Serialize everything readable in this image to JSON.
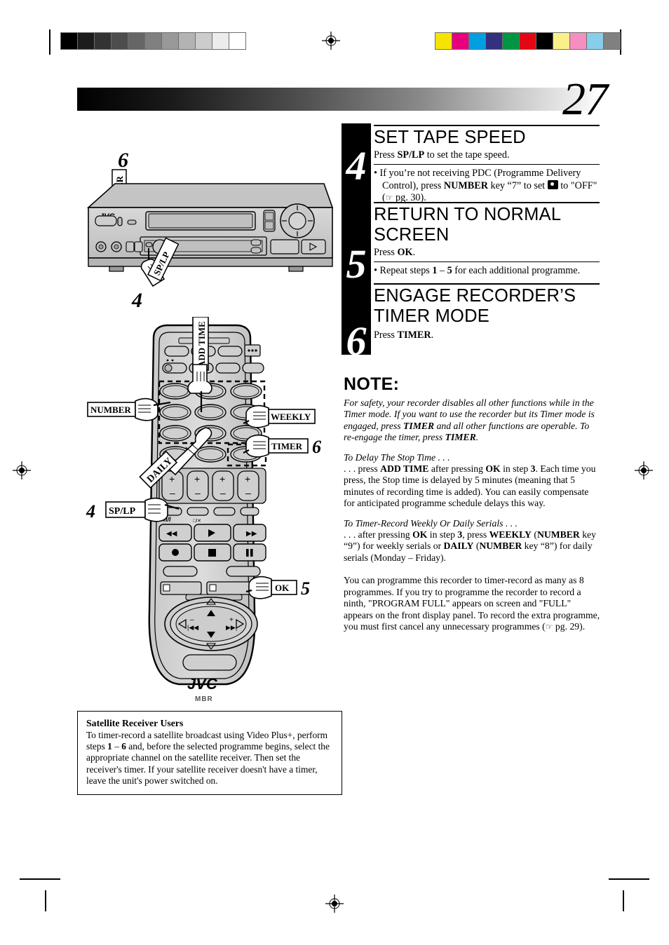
{
  "page": {
    "number": "27"
  },
  "printer_marks": {
    "grayscale_wedge": [
      "#000000",
      "#1c1c1c",
      "#333333",
      "#4d4d4d",
      "#666666",
      "#808080",
      "#999999",
      "#b3b3b3",
      "#cccccc",
      "#ececec",
      "#ffffff"
    ],
    "color_bar": [
      "#f5e400",
      "#e6007e",
      "#00a0e0",
      "#33307f",
      "#009543",
      "#e30613",
      "#000000",
      "#faf08a",
      "#f58fc2",
      "#87ceeb",
      "#808080"
    ]
  },
  "steps": [
    {
      "number": "4",
      "title": "SET TAPE SPEED",
      "instruction_prefix": "Press ",
      "instruction_bold": "SP/LP",
      "instruction_suffix": " to set the tape speed.",
      "bullet": "If you're not receiving PDC (Programme Delivery Control), press NUMBER key “7” to set ⌘ to \"OFF\" (☞ pg. 30)."
    },
    {
      "number": "5",
      "title": "RETURN TO NORMAL SCREEN",
      "instruction_prefix": "Press ",
      "instruction_bold": "OK",
      "instruction_suffix": ".",
      "bullet": "Repeat steps 1 – 5 for each additional programme."
    },
    {
      "number": "6",
      "title": "ENGAGE RECORDER’S TIMER MODE",
      "instruction_prefix": "Press ",
      "instruction_bold": "TIMER",
      "instruction_suffix": ".",
      "bullet": ""
    }
  ],
  "note": {
    "heading": "NOTE:",
    "paragraph1": "For safety, your recorder disables all other functions while in the Timer mode. If you want to use the recorder but its Timer mode is engaged, press TIMER and all other functions are operable. To re-engage the timer, press TIMER.",
    "paragraph2_heading": "To Delay The Stop Time . . .",
    "paragraph2": ". . . press ADD TIME after pressing OK in step 3. Each time you press, the Stop time is delayed by 5 minutes (meaning that 5 minutes of recording time is added). You can easily compensate for anticipated programme schedule delays this way.",
    "paragraph3_heading": "To Timer-Record Weekly Or Daily Serials . . .",
    "paragraph3": ". . . after pressing OK in step 3, press WEEKLY (NUMBER key “9”) for weekly serials or DAILY (NUMBER key “8”) for daily serials (Monday – Friday).",
    "paragraph4": "You can programme this recorder to timer-record as many as 8 programmes. If you try to programme the recorder to record a ninth, \"PROGRAM FULL\" appears on screen and \"FULL\" appears on the front display panel. To record the extra programme, you must first cancel any unnecessary programmes (☞ pg. 29)."
  },
  "satellite_box": {
    "heading": "Satellite Receiver Users",
    "body": "To timer-record a satellite broadcast using Video Plus+, perform steps 1 – 6 and, before the selected programme begins, select the appropriate channel on the satellite receiver. Then set the receiver's timer. If your satellite receiver doesn't have a timer, leave the unit's power switched on."
  },
  "vcr_figure": {
    "brand": "JVC",
    "callouts": [
      {
        "step": "6",
        "label": "TIMER"
      },
      {
        "step": "4",
        "label": "SP/LP"
      }
    ]
  },
  "remote_figure": {
    "brand": "JVC",
    "sub_brand": "MBR",
    "callouts": [
      {
        "label": "ADD TIME",
        "step": ""
      },
      {
        "label": "NUMBER",
        "step": ""
      },
      {
        "label": "WEEKLY",
        "step": ""
      },
      {
        "label": "TIMER",
        "step": "6"
      },
      {
        "label": "DAILY",
        "step": ""
      },
      {
        "label": "SP/LP",
        "step": "4"
      },
      {
        "label": "OK",
        "step": "5"
      }
    ]
  }
}
